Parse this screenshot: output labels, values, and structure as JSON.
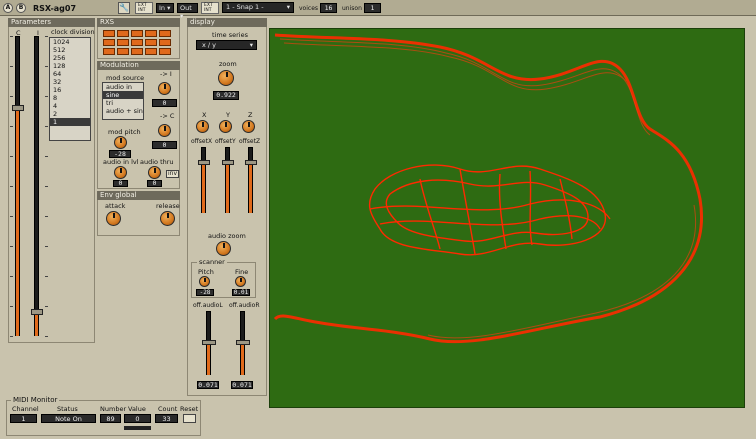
{
  "toolbar": {
    "a_label": "A",
    "b_label": "B",
    "title": "RSX-ag07",
    "ext_int_1": [
      "EXT",
      "INT"
    ],
    "in_label": "In",
    "out_label": "Out",
    "ext_int_2": [
      "EXT",
      "INT"
    ],
    "snapshot": "1 - Snap 1 -",
    "voices_label": "voices",
    "voices_value": "16",
    "unison_label": "unison",
    "unison_value": "1"
  },
  "parameters": {
    "header": "Parameters",
    "c_label": "C",
    "i_label": "I",
    "slider_c_level": 0.76,
    "slider_i_level": 0.08,
    "clock_division_label": "clock division",
    "clock_division_items": [
      "1024",
      "512",
      "256",
      "128",
      "64",
      "32",
      "16",
      "8",
      "4",
      "2",
      "1"
    ],
    "clock_division_selected": 10
  },
  "rxs": {
    "header": "RXS"
  },
  "modulation": {
    "header": "Modulation",
    "mod_source_label": "mod source",
    "mod_source_items": [
      "audio in",
      "sine",
      "tri",
      "audio + sin"
    ],
    "mod_source_selected": 1,
    "to_i_label": "-> I",
    "to_i_value": "0",
    "to_c_label": "-> C",
    "to_c_value": "0",
    "mod_pitch_label": "mod pitch",
    "mod_pitch_value": "-28",
    "audio_in_lvl_label": "audio in lvl",
    "audio_in_lvl_value": "0",
    "audio_thru_label": "audio thru",
    "audio_thru_value": "0",
    "inv_label": "inv"
  },
  "env": {
    "header": "Env global",
    "attack_label": "attack",
    "release_label": "release"
  },
  "display": {
    "header": "display",
    "time_series_label": "time series",
    "mode_value": "x / y",
    "zoom_label": "zoom",
    "zoom_value": "0.922",
    "x_label": "X",
    "y_label": "Y",
    "z_label": "Z",
    "offset_x_label": "offsetX",
    "offset_y_label": "offsetY",
    "offset_z_label": "offsetZ",
    "offset_x_level": 0.75,
    "offset_y_level": 0.75,
    "offset_z_level": 0.75,
    "audio_zoom_label": "audio zoom",
    "scanner_label": "scanner",
    "pitch_label": "Pitch",
    "pitch_value": "-28",
    "fine_label": "Fine",
    "fine_value": "0.01",
    "off_audio_l_label": "off.audioL",
    "off_audio_r_label": "off.audioR",
    "off_audio_l_value": "0.071",
    "off_audio_r_value": "0.071",
    "off_audio_l_level": 0.5,
    "off_audio_r_level": 0.5,
    "colors": {
      "background": "#2e6b12",
      "trace": "#ff2a00"
    }
  },
  "midi_monitor": {
    "header": "MIDI Monitor",
    "channel_label": "Channel",
    "status_label": "Status",
    "number_label": "Number",
    "value_label": "Value",
    "count_label": "Count",
    "reset_label": "Reset",
    "channel_value": "1",
    "status_value": "Note On",
    "number_value": "89",
    "value_value": "0",
    "count_value": "33"
  }
}
